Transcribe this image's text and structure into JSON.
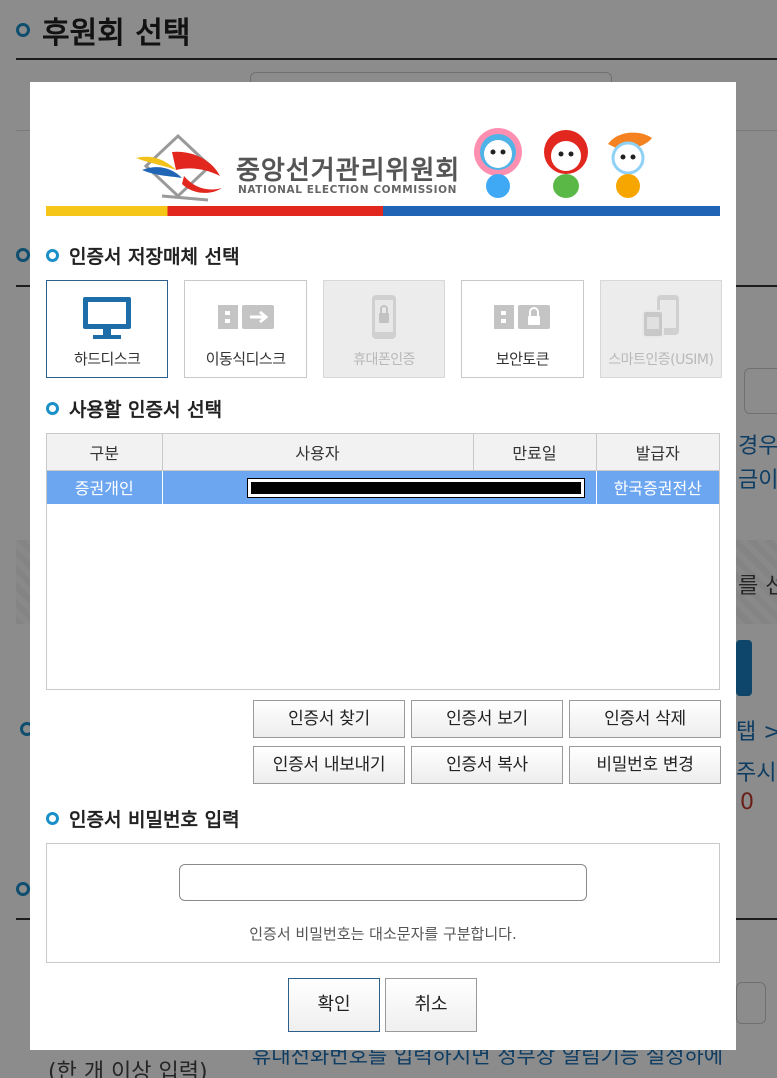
{
  "background": {
    "title": "후원회 선택",
    "fragments": {
      "right_a": "경우",
      "right_b": "금이",
      "right_c": "를 선",
      "right_d": "탭 >",
      "right_e": "주시",
      "right_f": "0",
      "bottom_left": "(한 개 이상 입력)",
      "bottom_right": "휴대전화번호를 입력하시면 정부장 알림기능 설정하에"
    }
  },
  "dialog": {
    "logo": {
      "korean": "중앙선거관리위원회",
      "english": "NATIONAL ELECTION COMMISSION"
    },
    "storage": {
      "title": "인증서 저장매체 선택",
      "media": [
        {
          "label": "하드디스크",
          "icon": "monitor-icon",
          "state": "selected"
        },
        {
          "label": "이동식디스크",
          "icon": "usb-drive-icon",
          "state": "enabled"
        },
        {
          "label": "휴대폰인증",
          "icon": "phone-lock-icon",
          "state": "disabled"
        },
        {
          "label": "보안토큰",
          "icon": "security-token-icon",
          "state": "enabled"
        },
        {
          "label": "스마트인증(USIM)",
          "icon": "smart-usim-icon",
          "state": "disabled"
        }
      ]
    },
    "cert_select": {
      "title": "사용할 인증서 선택",
      "columns": [
        "구분",
        "사용자",
        "만료일",
        "발급자"
      ],
      "rows": [
        {
          "type": "증권개인",
          "user": "",
          "expiry": "",
          "issuer": "한국증권전산"
        }
      ]
    },
    "actions": [
      "인증서 찾기",
      "인증서 보기",
      "인증서 삭제",
      "인증서 내보내기",
      "인증서 복사",
      "비밀번호 변경"
    ],
    "password": {
      "title": "인증서 비밀번호 입력",
      "value": "",
      "note": "인증서 비밀번호는 대소문자를 구분합니다."
    },
    "ok_label": "확인",
    "cancel_label": "취소"
  },
  "colors": {
    "accent": "#1a8fc8",
    "selected_row": "#6da6f0",
    "overlay": "rgba(0,0,0,0.45)"
  }
}
